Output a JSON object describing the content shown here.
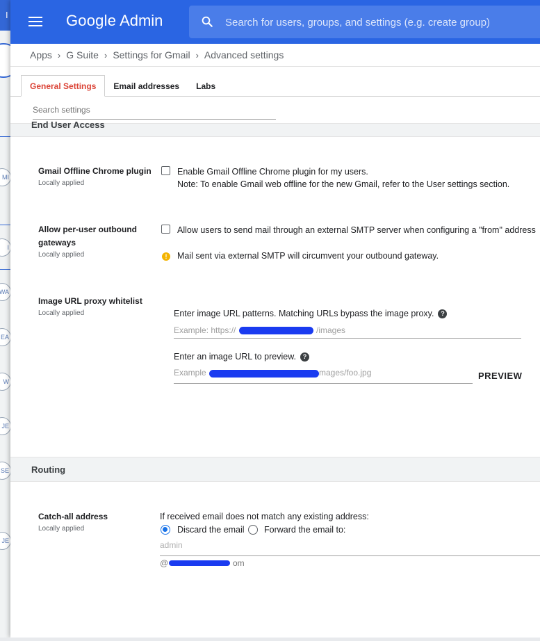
{
  "header": {
    "app_name": "Google Admin",
    "logo_google": "Google",
    "logo_admin": "Admin",
    "search_placeholder": "Search for users, groups, and settings (e.g. create group)",
    "brand_color": "#2a65e3"
  },
  "background_window": {
    "title_char": "I",
    "avatars": [
      "MI",
      "I",
      "WA",
      "EA",
      "W",
      "JE",
      "SE",
      "JE"
    ]
  },
  "breadcrumb": [
    "Apps",
    "G Suite",
    "Settings for Gmail",
    "Advanced settings"
  ],
  "tabs": [
    {
      "label": "General Settings",
      "active": true
    },
    {
      "label": "Email addresses",
      "active": false
    },
    {
      "label": "Labs",
      "active": false
    }
  ],
  "settings_search_placeholder": "Search settings",
  "sections": {
    "end_user_access": {
      "title": "End User Access",
      "offline": {
        "label": "Gmail Offline Chrome plugin",
        "sub": "Locally applied",
        "checkbox_label": "Enable Gmail Offline Chrome plugin for my users.",
        "note": "Note: To enable Gmail web offline for the new Gmail, refer to the User settings section."
      },
      "gateway": {
        "label_line1": "Allow per-user outbound",
        "label_line2": "gateways",
        "sub": "Locally applied",
        "checkbox_label": "Allow users to send mail through an external SMTP server when configuring a \"from\" address",
        "warning": "Mail sent via external SMTP will circumvent your outbound gateway."
      },
      "proxy": {
        "label": "Image URL proxy whitelist",
        "sub": "Locally applied",
        "patterns_label": "Enter image URL patterns. Matching URLs bypass the image proxy.",
        "patterns_placeholder": "Example: https://",
        "patterns_placeholder_tail": "/images",
        "preview_label": "Enter an image URL to preview.",
        "preview_placeholder": "Example",
        "preview_placeholder_tail": "mages/foo.jpg",
        "preview_button": "PREVIEW",
        "help_glyph": "?"
      }
    },
    "routing": {
      "title": "Routing",
      "catchall": {
        "label": "Catch-all address",
        "sub": "Locally applied",
        "prompt": "If received email does not match any existing address:",
        "option_discard": "Discard the email",
        "option_forward": "Forward the email to:",
        "selected": "discard",
        "forward_placeholder": "admin",
        "domain_prefix": "@",
        "domain_suffix": "om"
      }
    }
  },
  "warning_glyph": "!"
}
